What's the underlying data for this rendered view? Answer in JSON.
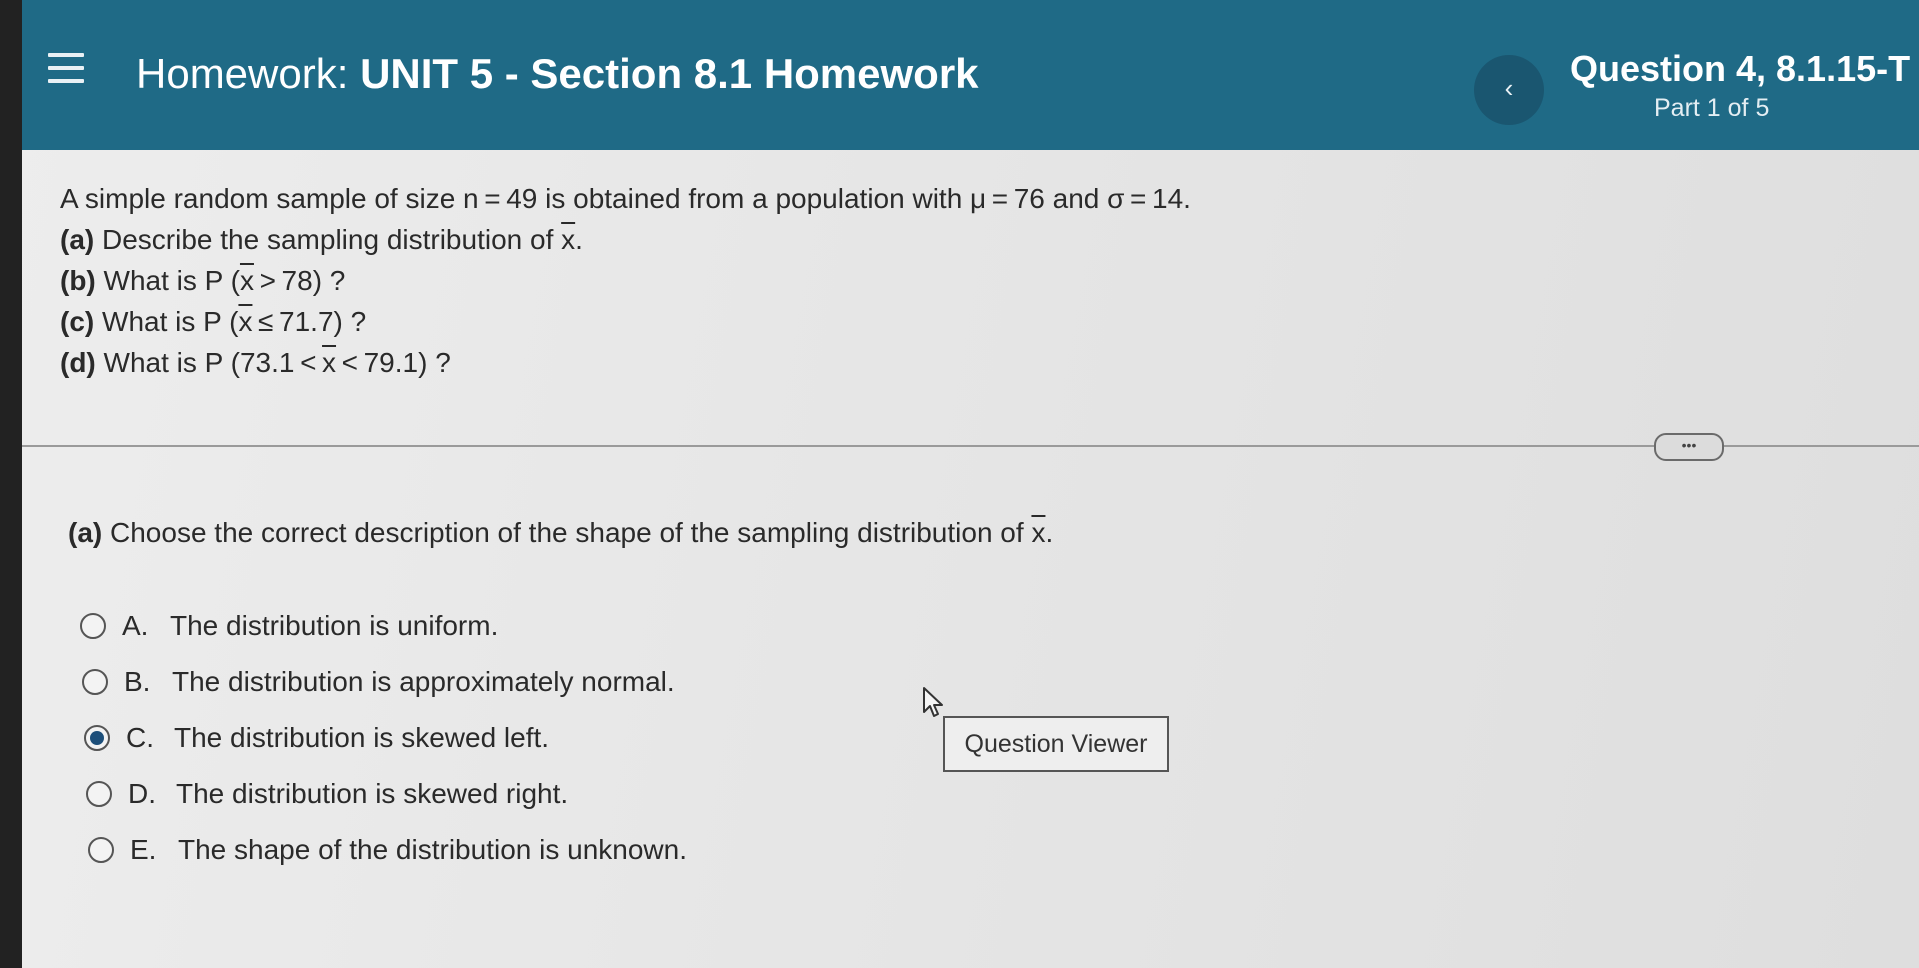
{
  "header": {
    "title_prefix": "Homework:",
    "title_main": "UNIT 5 - Section 8.1 Homework",
    "prev_icon": "chevron-left-icon",
    "prev_symbol": "‹",
    "question_label": "Question 4, 8.1.15-T",
    "part_label": "Part 1 of 5"
  },
  "prompt": {
    "intro": "A simple random sample of size n = 49 is obtained from a population with μ = 76 and σ = 14.",
    "a_label": "(a)",
    "a_text": "Describe the sampling distribution of",
    "a_symbol": "x",
    "a_end": ".",
    "b_label": "(b)",
    "b_text": "What is P",
    "b_open": "(",
    "b_symbol": "x",
    "b_rest": " > 78",
    "b_close": ")",
    "b_end": "?",
    "c_label": "(c)",
    "c_text": "What is P",
    "c_open": "(",
    "c_symbol": "x",
    "c_rest": " ≤ 71.7",
    "c_close": ")",
    "c_end": "?",
    "d_label": "(d)",
    "d_text": "What is P",
    "d_open": "(",
    "d_before": "73.1 < ",
    "d_symbol": "x",
    "d_rest": " < 79.1",
    "d_close": ")",
    "d_end": "?"
  },
  "more_button_label": "•••",
  "part_a": {
    "label": "(a)",
    "text": "Choose the correct description of the shape of the sampling distribution of",
    "symbol": "x",
    "end": "."
  },
  "options": [
    {
      "letter": "A.",
      "text": "The distribution is uniform.",
      "selected": false
    },
    {
      "letter": "B.",
      "text": "The distribution is approximately normal.",
      "selected": false
    },
    {
      "letter": "C.",
      "text": "The distribution is skewed left.",
      "selected": true
    },
    {
      "letter": "D.",
      "text": "The distribution is skewed right.",
      "selected": false
    },
    {
      "letter": "E.",
      "text": "The shape of the distribution is unknown.",
      "selected": false
    }
  ],
  "question_viewer_label": "Question Viewer",
  "colors": {
    "header": "#1f6a86",
    "radio_selected": "#1d4f7a"
  }
}
